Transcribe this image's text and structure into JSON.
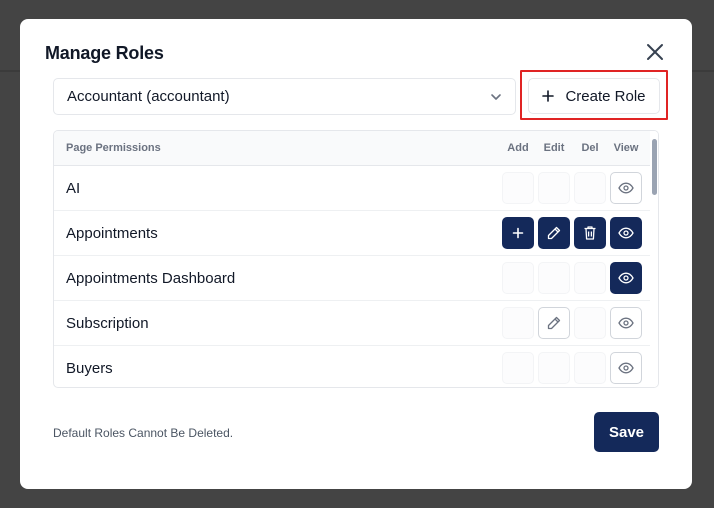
{
  "modal": {
    "title": "Manage Roles"
  },
  "role_select": {
    "value": "Accountant (accountant)"
  },
  "create_role": {
    "label": "Create Role"
  },
  "permissions": {
    "header": {
      "page": "Page Permissions",
      "add": "Add",
      "edit": "Edit",
      "del": "Del",
      "view": "View"
    },
    "rows": [
      {
        "name": "AI",
        "add": "off",
        "edit": "off",
        "del": "off",
        "view": "outline"
      },
      {
        "name": "Appointments",
        "add": "on",
        "edit": "on",
        "del": "on",
        "view": "on"
      },
      {
        "name": "Appointments Dashboard",
        "add": "off",
        "edit": "off",
        "del": "off",
        "view": "on"
      },
      {
        "name": "Subscription",
        "add": "off",
        "edit": "outline",
        "del": "off",
        "view": "outline"
      },
      {
        "name": "Buyers",
        "add": "off",
        "edit": "off",
        "del": "off",
        "view": "outline"
      }
    ]
  },
  "footer": {
    "note": "Default Roles Cannot Be Deleted.",
    "save_label": "Save"
  },
  "icons": {
    "close": "close-icon",
    "chevron": "chevron-down-icon",
    "plus": "plus-icon",
    "add": "plus-icon",
    "edit": "pencil-icon",
    "del": "trash-icon",
    "view": "eye-icon"
  },
  "colors": {
    "primary": "#14295a",
    "highlight": "#e02424"
  }
}
